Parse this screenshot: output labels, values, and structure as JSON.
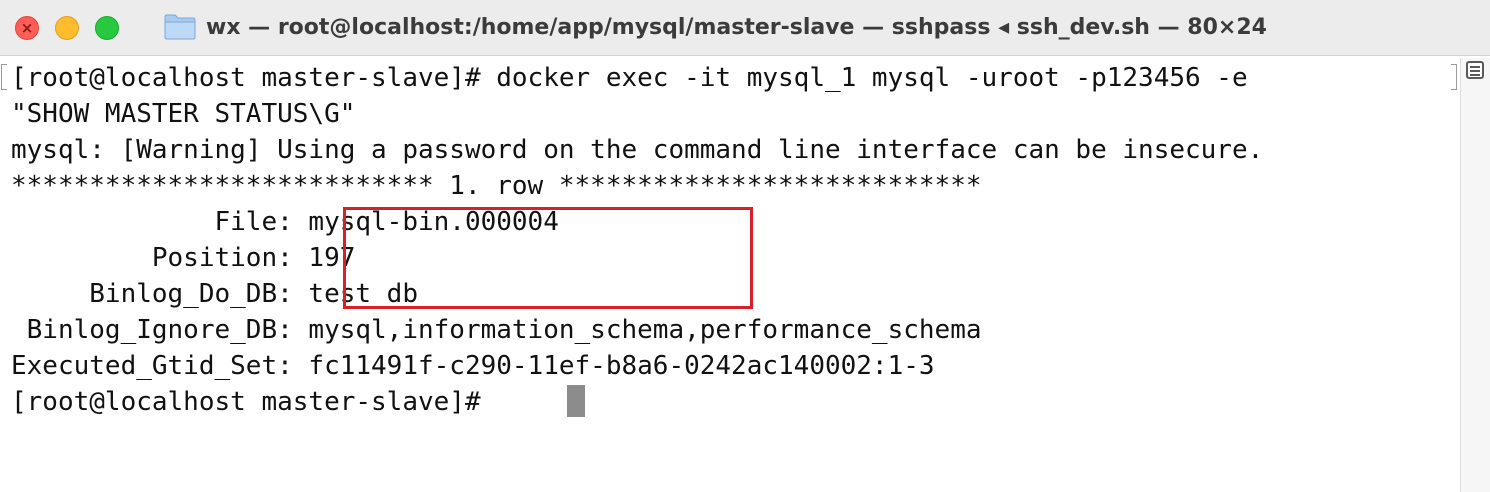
{
  "window": {
    "title": "wx — root@localhost:/home/app/mysql/master-slave — sshpass ◂ ssh_dev.sh — 80×24",
    "colors": {
      "close": "#fe5f57",
      "minimize": "#febc2e",
      "zoom": "#28c840",
      "highlight": "#d6202b"
    }
  },
  "terminal": {
    "lines": [
      "[root@localhost master-slave]# docker exec -it mysql_1 mysql -uroot -p123456 -e",
      "\"SHOW MASTER STATUS\\G\"",
      "mysql: [Warning] Using a password on the command line interface can be insecure.",
      "*************************** 1. row ***************************",
      "             File: mysql-bin.000004",
      "         Position: 197",
      "     Binlog_Do_DB: test_db",
      " Binlog_Ignore_DB: mysql,information_schema,performance_schema",
      "Executed_Gtid_Set: fc11491f-c290-11ef-b8a6-0242ac140002:1-3",
      "[root@localhost master-slave]# "
    ]
  }
}
